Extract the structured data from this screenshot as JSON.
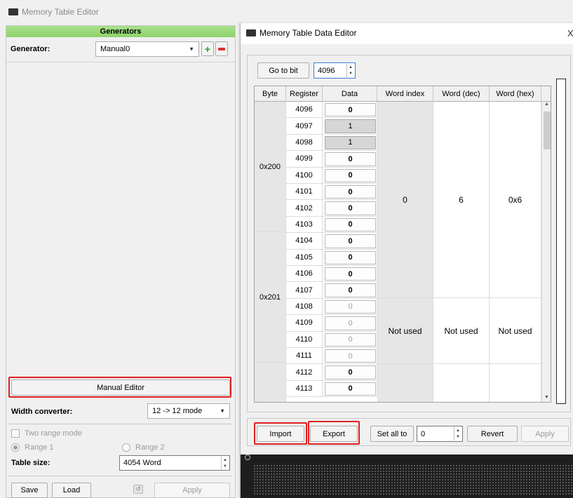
{
  "main_window": {
    "title": "Memory Table Editor"
  },
  "generators": {
    "header": "Generators",
    "generator_label": "Generator:",
    "generator_value": "Manual0"
  },
  "manual_editor_label": "Manual Editor",
  "width_converter": {
    "label": "Width converter:",
    "value": "12 -> 12 mode"
  },
  "two_range_mode": "Two range mode",
  "range1": "Range 1",
  "range2": "Range 2",
  "table_size": {
    "label": "Table size:",
    "value": "4054 Word"
  },
  "footer": {
    "save": "Save",
    "load": "Load",
    "apply": "Apply"
  },
  "dialog": {
    "title": "Memory Table Data Editor",
    "close": "X",
    "goto_label": "Go to bit",
    "goto_value": "4096",
    "columns": [
      "Byte",
      "Register",
      "Data",
      "Word index",
      "Word (dec)",
      "Word (hex)"
    ],
    "bytes": [
      "0x200",
      "0x201"
    ],
    "rows": [
      {
        "reg": "4096",
        "data": "0"
      },
      {
        "reg": "4097",
        "data": "1"
      },
      {
        "reg": "4098",
        "data": "1"
      },
      {
        "reg": "4099",
        "data": "0"
      },
      {
        "reg": "4100",
        "data": "0"
      },
      {
        "reg": "4101",
        "data": "0"
      },
      {
        "reg": "4102",
        "data": "0"
      },
      {
        "reg": "4103",
        "data": "0"
      },
      {
        "reg": "4104",
        "data": "0"
      },
      {
        "reg": "4105",
        "data": "0"
      },
      {
        "reg": "4106",
        "data": "0"
      },
      {
        "reg": "4107",
        "data": "0"
      },
      {
        "reg": "4108",
        "data": "0"
      },
      {
        "reg": "4109",
        "data": "0"
      },
      {
        "reg": "4110",
        "data": "0"
      },
      {
        "reg": "4111",
        "data": "0"
      },
      {
        "reg": "4112",
        "data": "0"
      },
      {
        "reg": "4113",
        "data": "0"
      }
    ],
    "word1": {
      "index": "0",
      "dec": "6",
      "hex": "0x6"
    },
    "word2": {
      "index": "Not used",
      "dec": "Not used",
      "hex": "Not used"
    },
    "import": "Import",
    "export": "Export",
    "set_all_to": "Set all to",
    "set_all_value": "0",
    "revert": "Revert",
    "apply": "Apply"
  }
}
